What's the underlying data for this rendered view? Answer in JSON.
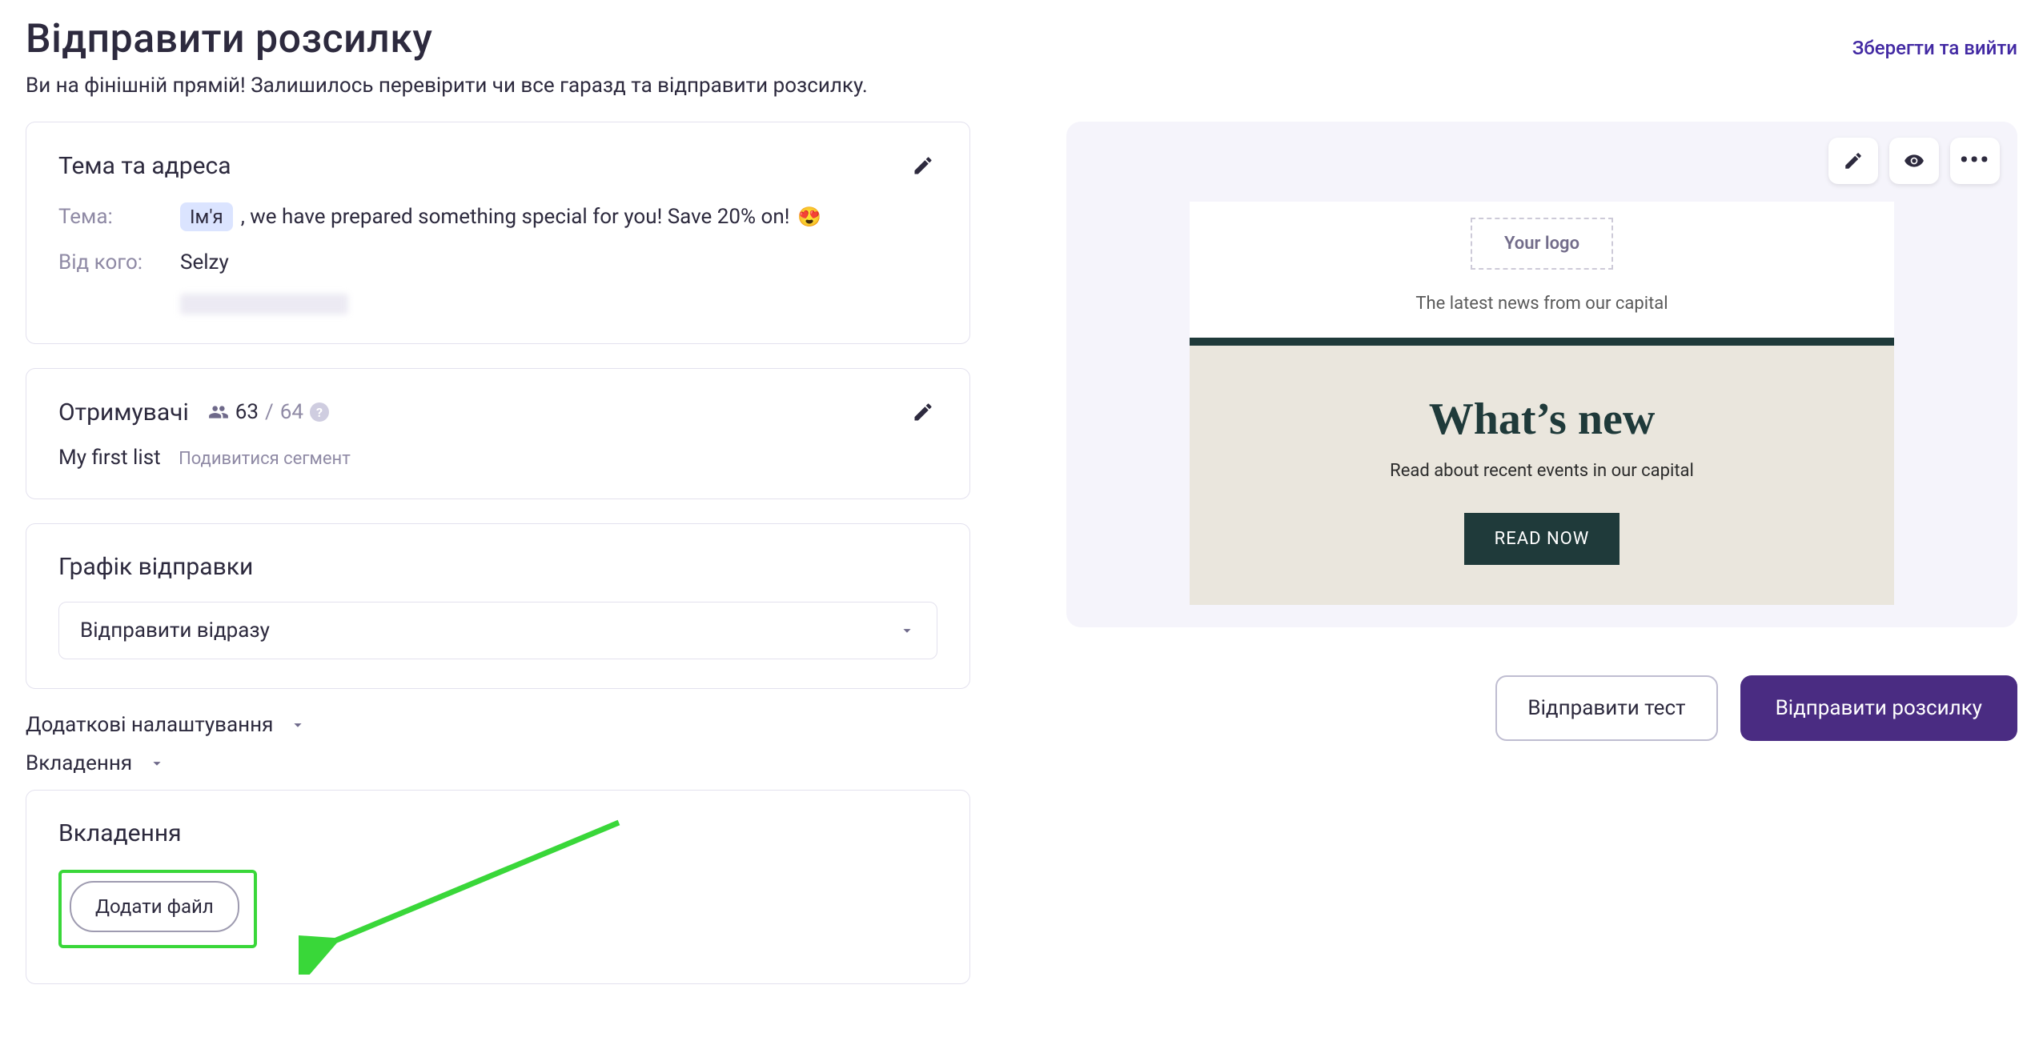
{
  "header": {
    "title": "Відправити розсилку",
    "subtitle": "Ви на фінішній прямій! Залишилось перевірити чи все гаразд та відправити розсилку.",
    "save_exit": "Зберегти та вийти"
  },
  "subject_card": {
    "title": "Тема та адреса",
    "subject_label": "Тема:",
    "subject_chip": "Ім'я",
    "subject_rest": ", we have prepared something special for you! Save 20% on!",
    "subject_emoji": "😍",
    "from_label": "Від кого:",
    "from_value": "Selzy"
  },
  "recipients_card": {
    "title": "Отримувачі",
    "count_active": "63",
    "count_total": "64",
    "list_name": "My first list",
    "view_segment": "Подивитися сегмент"
  },
  "schedule_card": {
    "title": "Графік відправки",
    "selected": "Відправити відразу"
  },
  "expanders": {
    "advanced": "Додаткові налаштування",
    "attachments": "Вкладення"
  },
  "attachments_card": {
    "title": "Вкладення",
    "add_file": "Додати файл"
  },
  "preview": {
    "logo_text": "Your logo",
    "tagline": "The latest news from our capital",
    "hero_title": "What’s new",
    "hero_sub": "Read about recent events in our capital",
    "cta": "READ NOW"
  },
  "actions": {
    "send_test": "Відправити тест",
    "send": "Відправити розсилку"
  }
}
